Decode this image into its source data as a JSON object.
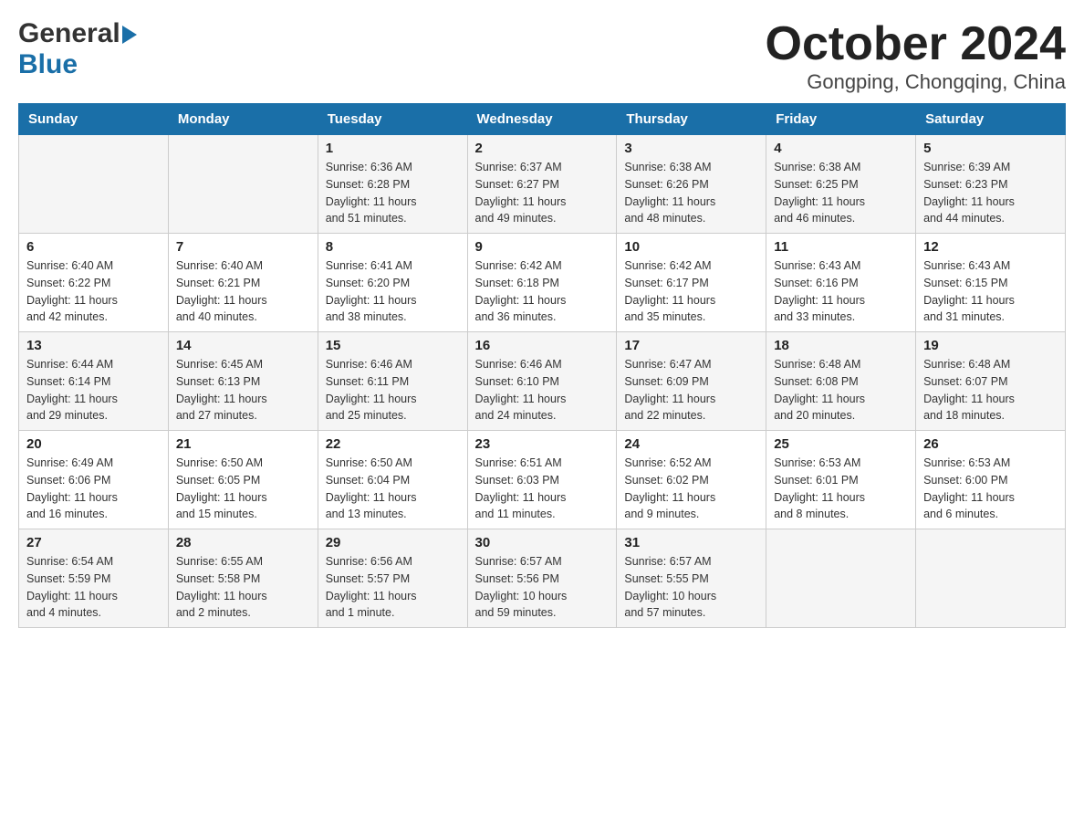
{
  "header": {
    "logo_general": "General",
    "logo_blue": "Blue",
    "title": "October 2024",
    "subtitle": "Gongping, Chongqing, China"
  },
  "weekdays": [
    "Sunday",
    "Monday",
    "Tuesday",
    "Wednesday",
    "Thursday",
    "Friday",
    "Saturday"
  ],
  "weeks": [
    [
      {
        "day": "",
        "detail": ""
      },
      {
        "day": "",
        "detail": ""
      },
      {
        "day": "1",
        "detail": "Sunrise: 6:36 AM\nSunset: 6:28 PM\nDaylight: 11 hours\nand 51 minutes."
      },
      {
        "day": "2",
        "detail": "Sunrise: 6:37 AM\nSunset: 6:27 PM\nDaylight: 11 hours\nand 49 minutes."
      },
      {
        "day": "3",
        "detail": "Sunrise: 6:38 AM\nSunset: 6:26 PM\nDaylight: 11 hours\nand 48 minutes."
      },
      {
        "day": "4",
        "detail": "Sunrise: 6:38 AM\nSunset: 6:25 PM\nDaylight: 11 hours\nand 46 minutes."
      },
      {
        "day": "5",
        "detail": "Sunrise: 6:39 AM\nSunset: 6:23 PM\nDaylight: 11 hours\nand 44 minutes."
      }
    ],
    [
      {
        "day": "6",
        "detail": "Sunrise: 6:40 AM\nSunset: 6:22 PM\nDaylight: 11 hours\nand 42 minutes."
      },
      {
        "day": "7",
        "detail": "Sunrise: 6:40 AM\nSunset: 6:21 PM\nDaylight: 11 hours\nand 40 minutes."
      },
      {
        "day": "8",
        "detail": "Sunrise: 6:41 AM\nSunset: 6:20 PM\nDaylight: 11 hours\nand 38 minutes."
      },
      {
        "day": "9",
        "detail": "Sunrise: 6:42 AM\nSunset: 6:18 PM\nDaylight: 11 hours\nand 36 minutes."
      },
      {
        "day": "10",
        "detail": "Sunrise: 6:42 AM\nSunset: 6:17 PM\nDaylight: 11 hours\nand 35 minutes."
      },
      {
        "day": "11",
        "detail": "Sunrise: 6:43 AM\nSunset: 6:16 PM\nDaylight: 11 hours\nand 33 minutes."
      },
      {
        "day": "12",
        "detail": "Sunrise: 6:43 AM\nSunset: 6:15 PM\nDaylight: 11 hours\nand 31 minutes."
      }
    ],
    [
      {
        "day": "13",
        "detail": "Sunrise: 6:44 AM\nSunset: 6:14 PM\nDaylight: 11 hours\nand 29 minutes."
      },
      {
        "day": "14",
        "detail": "Sunrise: 6:45 AM\nSunset: 6:13 PM\nDaylight: 11 hours\nand 27 minutes."
      },
      {
        "day": "15",
        "detail": "Sunrise: 6:46 AM\nSunset: 6:11 PM\nDaylight: 11 hours\nand 25 minutes."
      },
      {
        "day": "16",
        "detail": "Sunrise: 6:46 AM\nSunset: 6:10 PM\nDaylight: 11 hours\nand 24 minutes."
      },
      {
        "day": "17",
        "detail": "Sunrise: 6:47 AM\nSunset: 6:09 PM\nDaylight: 11 hours\nand 22 minutes."
      },
      {
        "day": "18",
        "detail": "Sunrise: 6:48 AM\nSunset: 6:08 PM\nDaylight: 11 hours\nand 20 minutes."
      },
      {
        "day": "19",
        "detail": "Sunrise: 6:48 AM\nSunset: 6:07 PM\nDaylight: 11 hours\nand 18 minutes."
      }
    ],
    [
      {
        "day": "20",
        "detail": "Sunrise: 6:49 AM\nSunset: 6:06 PM\nDaylight: 11 hours\nand 16 minutes."
      },
      {
        "day": "21",
        "detail": "Sunrise: 6:50 AM\nSunset: 6:05 PM\nDaylight: 11 hours\nand 15 minutes."
      },
      {
        "day": "22",
        "detail": "Sunrise: 6:50 AM\nSunset: 6:04 PM\nDaylight: 11 hours\nand 13 minutes."
      },
      {
        "day": "23",
        "detail": "Sunrise: 6:51 AM\nSunset: 6:03 PM\nDaylight: 11 hours\nand 11 minutes."
      },
      {
        "day": "24",
        "detail": "Sunrise: 6:52 AM\nSunset: 6:02 PM\nDaylight: 11 hours\nand 9 minutes."
      },
      {
        "day": "25",
        "detail": "Sunrise: 6:53 AM\nSunset: 6:01 PM\nDaylight: 11 hours\nand 8 minutes."
      },
      {
        "day": "26",
        "detail": "Sunrise: 6:53 AM\nSunset: 6:00 PM\nDaylight: 11 hours\nand 6 minutes."
      }
    ],
    [
      {
        "day": "27",
        "detail": "Sunrise: 6:54 AM\nSunset: 5:59 PM\nDaylight: 11 hours\nand 4 minutes."
      },
      {
        "day": "28",
        "detail": "Sunrise: 6:55 AM\nSunset: 5:58 PM\nDaylight: 11 hours\nand 2 minutes."
      },
      {
        "day": "29",
        "detail": "Sunrise: 6:56 AM\nSunset: 5:57 PM\nDaylight: 11 hours\nand 1 minute."
      },
      {
        "day": "30",
        "detail": "Sunrise: 6:57 AM\nSunset: 5:56 PM\nDaylight: 10 hours\nand 59 minutes."
      },
      {
        "day": "31",
        "detail": "Sunrise: 6:57 AM\nSunset: 5:55 PM\nDaylight: 10 hours\nand 57 minutes."
      },
      {
        "day": "",
        "detail": ""
      },
      {
        "day": "",
        "detail": ""
      }
    ]
  ]
}
